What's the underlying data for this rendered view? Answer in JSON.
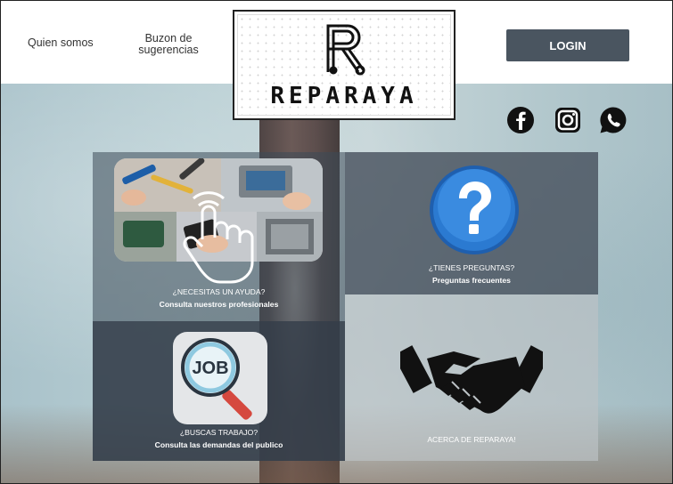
{
  "header": {
    "nav": [
      {
        "label": "Quien somos"
      },
      {
        "label": "Buzon de sugerencias"
      }
    ],
    "logo_text": "REPARAYA",
    "login_label": "LOGIN"
  },
  "social": [
    {
      "icon": "facebook-icon"
    },
    {
      "icon": "instagram-icon"
    },
    {
      "icon": "whatsapp-icon"
    }
  ],
  "tiles": {
    "help": {
      "title": "¿NECESITAS UN AYUDA?",
      "subtitle": "Consulta nuestros profesionales"
    },
    "faq": {
      "title": "¿TIENES PREGUNTAS?",
      "subtitle": "Preguntas frecuentes"
    },
    "job": {
      "title": "¿BUSCAS TRABAJO?",
      "subtitle": "Consulta las demandas del publico",
      "badge": "JOB"
    },
    "about": {
      "title": "ACERCA DE REPARAYA!"
    }
  },
  "colors": {
    "login_bg": "#4a5560",
    "question_blue": "#2b6fb8",
    "tile_dark": "#343e4a"
  }
}
